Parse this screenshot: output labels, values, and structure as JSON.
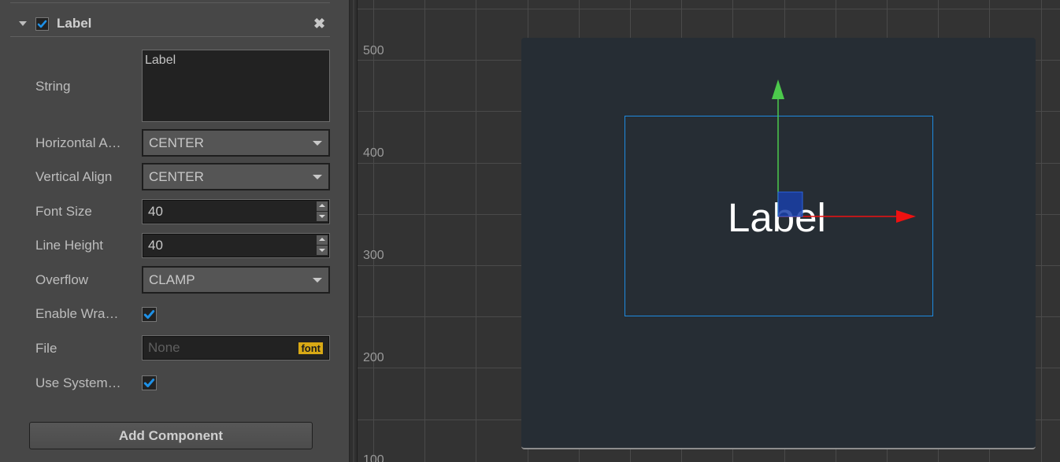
{
  "inspector": {
    "component": {
      "title": "Label",
      "enabled": true,
      "collapse_icon": "triangle-down-icon",
      "remove_icon": "close-x-icon",
      "remove_glyph": "✖"
    },
    "properties": {
      "string": {
        "label": "String",
        "value": "Label"
      },
      "horizontal_align": {
        "label": "Horizontal A…",
        "value": "CENTER"
      },
      "vertical_align": {
        "label": "Vertical Align",
        "value": "CENTER"
      },
      "font_size": {
        "label": "Font Size",
        "value": "40"
      },
      "line_height": {
        "label": "Line Height",
        "value": "40"
      },
      "overflow": {
        "label": "Overflow",
        "value": "CLAMP"
      },
      "enable_wrap": {
        "label": "Enable Wra…",
        "checked": true
      },
      "file": {
        "label": "File",
        "placeholder": "None",
        "badge": "font"
      },
      "use_system_font": {
        "label": "Use System…",
        "checked": true
      }
    },
    "add_component_label": "Add Component"
  },
  "scene": {
    "y_axis_labels": [
      "500",
      "400",
      "300",
      "200",
      "100"
    ],
    "node_label_text": "Label",
    "colors": {
      "selection": "#1e8ae0",
      "gizmo_x": "#ee1111",
      "gizmo_y": "#4cc94c",
      "gizmo_center": "#1a3fa8",
      "canvas_bg": "#262d34",
      "font_badge": "#d9a915",
      "checkbox_check": "#1e90e6"
    }
  }
}
